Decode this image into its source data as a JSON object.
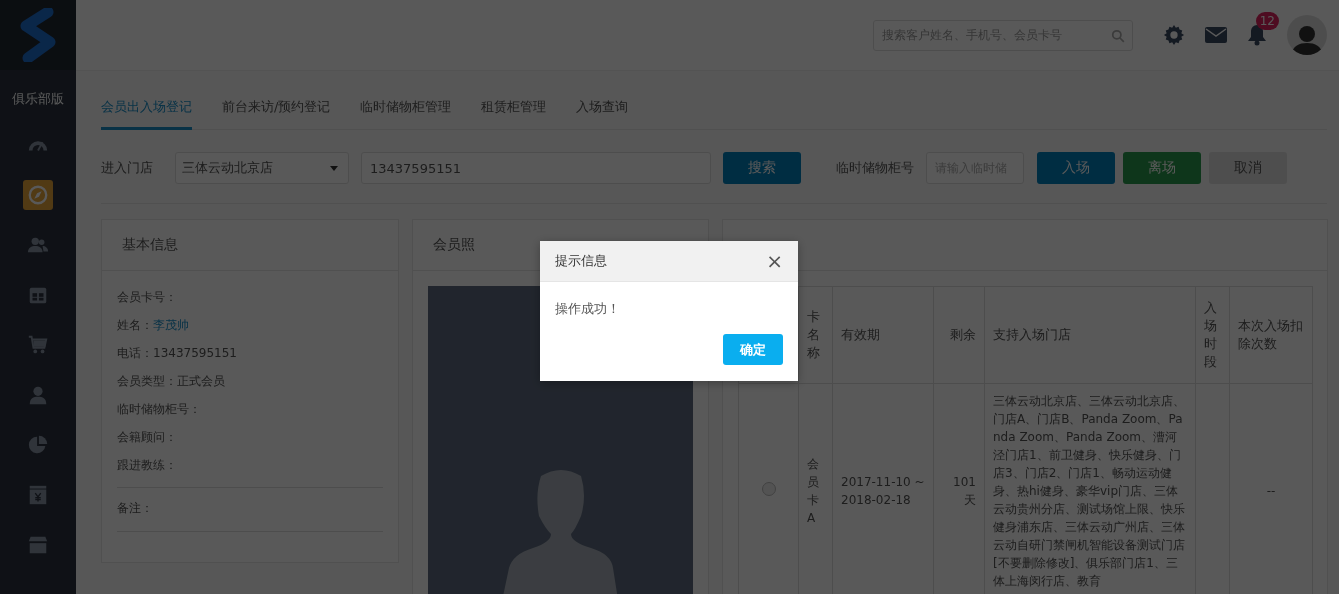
{
  "sidebar": {
    "brand": "俱乐部版",
    "items": [
      {
        "kind": "dashboard",
        "selected": false
      },
      {
        "kind": "compass",
        "selected": true
      },
      {
        "kind": "users",
        "selected": false
      },
      {
        "kind": "calendar",
        "selected": false
      },
      {
        "kind": "cart",
        "selected": false
      },
      {
        "kind": "user",
        "selected": false
      },
      {
        "kind": "pie",
        "selected": false
      },
      {
        "kind": "yen",
        "selected": false
      },
      {
        "kind": "store",
        "selected": false
      }
    ]
  },
  "header": {
    "search": {
      "placeholder": "搜索客户姓名、手机号、会员卡号"
    },
    "notifications": "12"
  },
  "tabs": [
    {
      "label": "会员出入场登记",
      "selected": true
    },
    {
      "label": "前台来访/预约登记",
      "selected": false
    },
    {
      "label": "临时储物柜管理",
      "selected": false
    },
    {
      "label": "租赁柜管理",
      "selected": false
    },
    {
      "label": "入场查询",
      "selected": false
    }
  ],
  "form": {
    "store_label": "进入门店",
    "store": "三体云动北京店",
    "query": "13437595151",
    "search_button": "搜索",
    "locker_label": "临时储物柜号",
    "locker": {
      "placeholder": "请输入临时储"
    },
    "buttons": [
      {
        "label": "入场",
        "kind": "primary",
        "disabled": false
      },
      {
        "label": "离场",
        "kind": "success",
        "disabled": false
      },
      {
        "label": "取消",
        "kind": "default",
        "disabled": true
      }
    ]
  },
  "basic_info": {
    "title": "基本信息",
    "fields": [
      {
        "label": "会员卡号："
      },
      {
        "label": "姓名：",
        "value": "李茂帅",
        "link": true
      },
      {
        "label": "电话：",
        "value": "13437595151",
        "link": false
      },
      {
        "label": "会员类型：",
        "value": "正式会员",
        "link": false
      },
      {
        "label": "临时储物柜号："
      },
      {
        "label": "会籍顾问："
      },
      {
        "label": "跟进教练："
      }
    ],
    "remark": "备注："
  },
  "photo": {
    "title": "会员照"
  },
  "cards": {
    "columns": [
      "卡名称",
      "有效期",
      "剩余",
      "支持入场门店",
      "入场时段",
      "本次入场扣除次数"
    ],
    "rows": [
      {
        "selected": false,
        "cells": [
          "会员卡A",
          "2017-11-10 ~ 2018-02-18",
          "101天",
          "三体云动北京店、三体云动北京店、门店A、门店B、Panda Zoom、Panda Zoom、Panda Zoom、漕河泾门店1、前卫健身、快乐健身、门店3、门店2、门店1、畅动运动健身、热hi健身、豪华vip门店、三体云动贵州分店、测试场馆上限、快乐健身浦东店、三体云动广州店、三体云动自研门禁闸机智能设备测试门店[不要删除修改]、俱乐部门店1、三体上海闵行店、教育",
          "",
          "--"
        ]
      }
    ]
  },
  "dialog": {
    "title": "提示信息",
    "close": "×",
    "message": "操作成功！",
    "confirm": "确定"
  }
}
